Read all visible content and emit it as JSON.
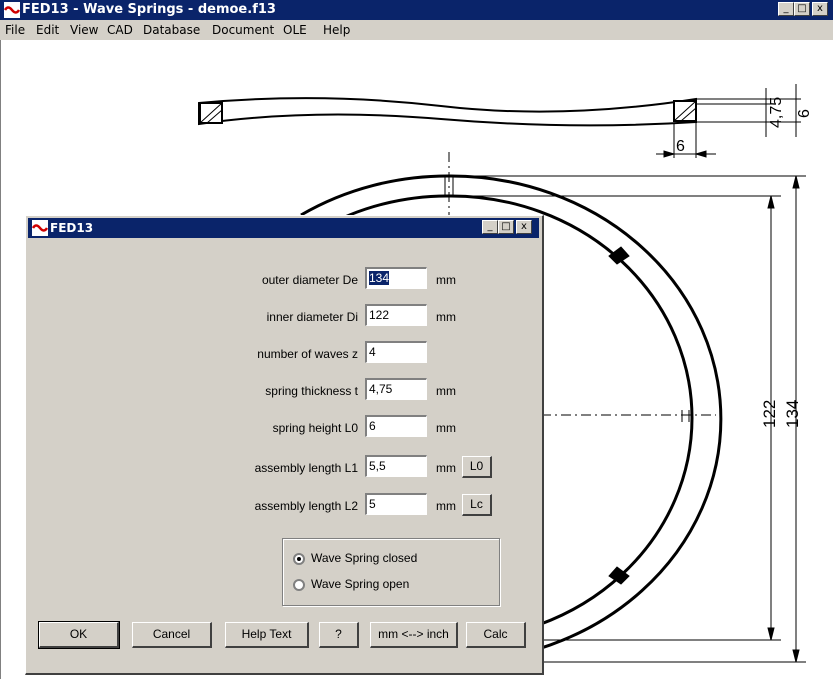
{
  "window": {
    "title": "FED13 - Wave Springs  -  demoe.f13",
    "controls": {
      "minimize": "_",
      "maximize": "□",
      "close": "x"
    }
  },
  "menu": [
    "File",
    "Edit",
    "View",
    "CAD",
    "Database",
    "Document",
    "OLE",
    "Help"
  ],
  "drawing": {
    "dims": {
      "t": "4,75",
      "h": "6",
      "w": "6",
      "di": "122",
      "de": "134"
    }
  },
  "dialog": {
    "title": "FED13",
    "fields": [
      {
        "label": "outer diameter De",
        "value": "134",
        "unit": "mm",
        "selected": true
      },
      {
        "label": "inner diameter Di",
        "value": "122",
        "unit": "mm"
      },
      {
        "label": "number of waves z",
        "value": "4",
        "unit": ""
      },
      {
        "label": "spring thickness t",
        "value": "4,75",
        "unit": "mm"
      },
      {
        "label": "spring height L0",
        "value": "6",
        "unit": "mm"
      },
      {
        "label": "assembly length L1",
        "value": "5,5",
        "unit": "mm",
        "button": "L0"
      },
      {
        "label": "assembly length L2",
        "value": "5",
        "unit": "mm",
        "button": "Lc"
      }
    ],
    "radio": [
      {
        "label": "Wave Spring closed",
        "checked": true
      },
      {
        "label": "Wave Spring open",
        "checked": false
      }
    ],
    "buttons": {
      "ok": "OK",
      "cancel": "Cancel",
      "help": "Help Text",
      "question": "?",
      "units": "mm <--> inch",
      "calc": "Calc"
    }
  }
}
